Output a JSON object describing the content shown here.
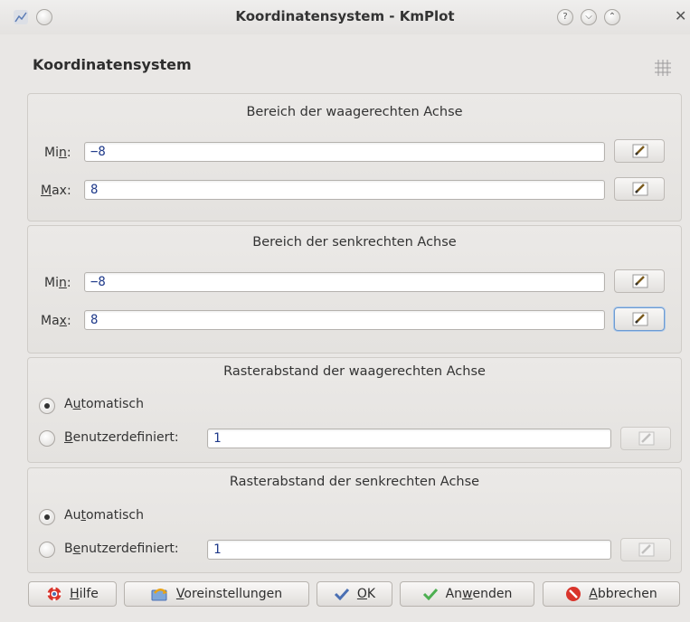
{
  "window": {
    "title": "Koordinatensystem - KmPlot"
  },
  "page": {
    "title": "Koordinatensystem"
  },
  "x_range": {
    "title": "Bereich der waagerechten Achse",
    "min_label": "Min:",
    "min_value": "−8",
    "max_label": "Max:",
    "max_value": "8"
  },
  "y_range": {
    "title": "Bereich der senkrechten Achse",
    "min_label": "Min:",
    "min_value": "−8",
    "max_label": "Max:",
    "max_value": "8"
  },
  "x_grid": {
    "title": "Rasterabstand der waagerechten Achse",
    "auto_label": "Automatisch",
    "custom_label": "Benutzerdefiniert:",
    "custom_value": "1",
    "selected": "auto"
  },
  "y_grid": {
    "title": "Rasterabstand der senkrechten Achse",
    "auto_label": "Automatisch",
    "custom_label": "Benutzerdefiniert:",
    "custom_value": "1",
    "selected": "auto"
  },
  "buttons": {
    "help": "Hilfe",
    "defaults": "Voreinstellungen",
    "ok": "OK",
    "apply": "Anwenden",
    "cancel": "Abbrechen"
  },
  "colors": {
    "value_text": "#1f3a8a",
    "focus_border": "#6e9bd1",
    "ok_check": "#4a6fb3",
    "apply_check": "#4caf50",
    "cancel_red": "#d9342b"
  }
}
